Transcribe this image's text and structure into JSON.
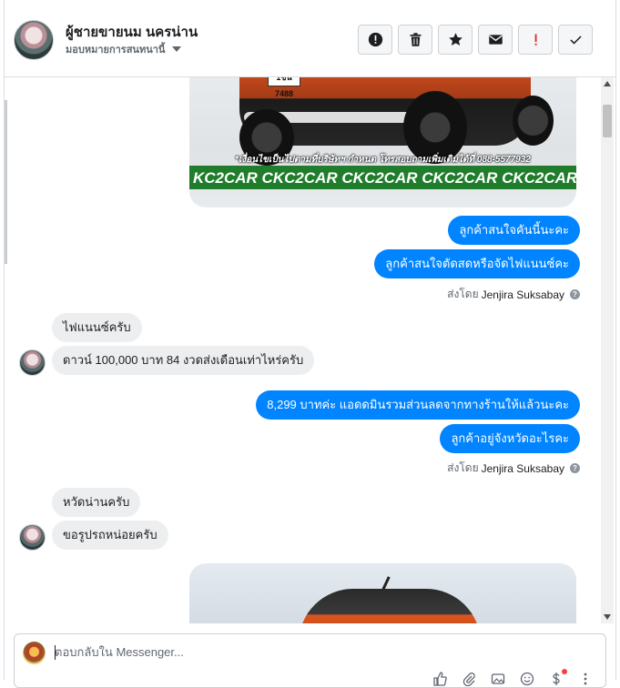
{
  "header": {
    "contact_name": "ผู้ชายขายนม นครน่าน",
    "assign_label": "มอบหมายการสนทนานี้",
    "actions": [
      {
        "name": "mark-spam-button",
        "icon": "alert-circle-icon"
      },
      {
        "name": "delete-button",
        "icon": "trash-icon"
      },
      {
        "name": "star-button",
        "icon": "star-icon"
      },
      {
        "name": "mark-unread-button",
        "icon": "envelope-icon"
      },
      {
        "name": "flag-button",
        "icon": "exclamation-icon"
      },
      {
        "name": "mark-done-button",
        "icon": "check-icon"
      }
    ]
  },
  "images": {
    "plate_text": "1ขน 7488",
    "fine_print": "*เงื่อนไขเป็นไปตามที่บริษัทฯ กำหนด โทรสอบถามเพิ่มเติมได้ที่ 088-5577932",
    "banner_text": "KC2CAR CKC2CAR CKC2CAR CKC2CAR CKC2CAR CKC2"
  },
  "messages": {
    "out1": "ลูกค้าสนใจคันนี้นะคะ",
    "out2": "ลูกค้าสนใจตัดสดหรือจัดไฟแนนซ์คะ",
    "sent_by_prefix": "ส่งโดย",
    "sent_by_name": "Jenjira Suksabay",
    "in1": "ไฟแนนซ์ครับ",
    "in2": "ดาวน์ 100,000 บาท 84 งวดส่งเดือนเท่าไหร่ครับ",
    "out3": "8,299 บาทค่ะ แอดดมินรวมส่วนลดจากทางร้านให้แล้วนะคะ",
    "out4": "ลูกค้าอยู่จังหวัดอะไรคะ",
    "in3": "หวัดน่านครับ",
    "in4": "ขอรูปรถหน่อยครับ"
  },
  "composer": {
    "placeholder": "ตอบกลับใน Messenger..."
  },
  "colors": {
    "outgoing_bubble": "#0084ff",
    "incoming_bubble": "#eceef0",
    "banner": "#1f7d2c"
  }
}
